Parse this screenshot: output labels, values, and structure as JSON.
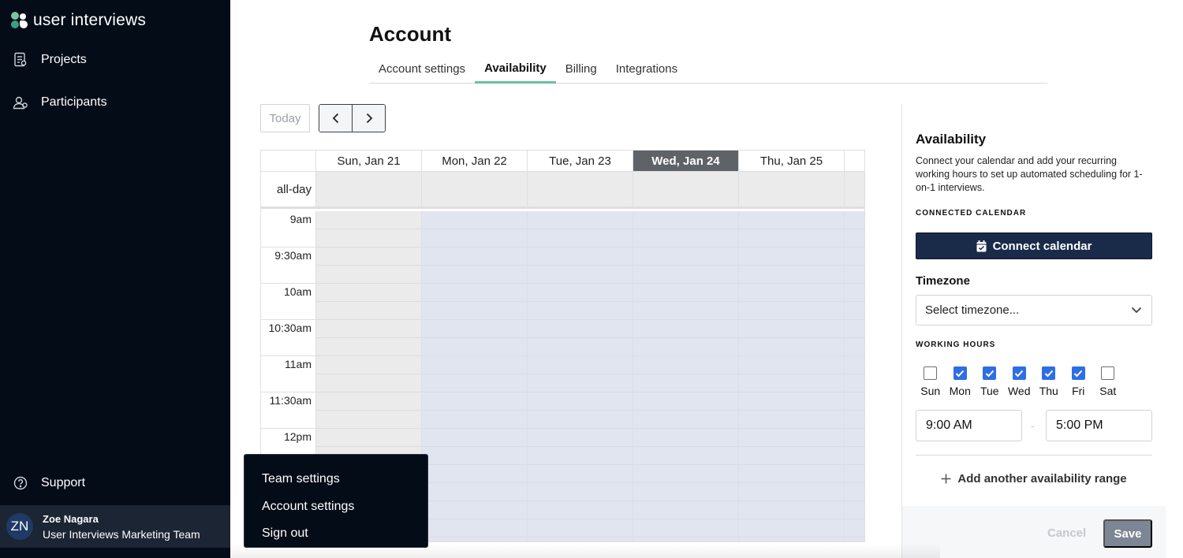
{
  "brand": {
    "logo_text": "user interviews",
    "logo_colors": [
      "#7ac4a6",
      "#ffffff",
      "#3aa17e"
    ]
  },
  "sidebar": {
    "items": [
      {
        "label": "Projects",
        "icon": "document-list-icon"
      },
      {
        "label": "Participants",
        "icon": "people-icon"
      }
    ],
    "support": {
      "label": "Support",
      "icon": "help-circle-icon"
    },
    "user": {
      "initials": "ZN",
      "name": "Zoe Nagara",
      "team": "User Interviews Marketing Team"
    }
  },
  "header": {
    "title": "Account",
    "tabs": [
      {
        "label": "Account settings",
        "active": false
      },
      {
        "label": "Availability",
        "active": true
      },
      {
        "label": "Billing",
        "active": false
      },
      {
        "label": "Integrations",
        "active": false
      }
    ],
    "accent_color": "#6bbfa3"
  },
  "calendar": {
    "today_label": "Today",
    "prev_icon": "chevron-left-icon",
    "next_icon": "chevron-right-icon",
    "allday_label": "all-day",
    "days": [
      {
        "label": "Sun, Jan 21",
        "today": false,
        "working": false
      },
      {
        "label": "Mon, Jan 22",
        "today": false,
        "working": true
      },
      {
        "label": "Tue, Jan 23",
        "today": false,
        "working": true
      },
      {
        "label": "Wed, Jan 24",
        "today": true,
        "working": true
      },
      {
        "label": "Thu, Jan 25",
        "today": false,
        "working": true
      }
    ],
    "times": [
      "9am",
      "9:30am",
      "10am",
      "10:30am",
      "11am",
      "11:30am",
      "12pm"
    ],
    "working_color": "#e1e5f0",
    "off_color": "#ebebeb"
  },
  "panel": {
    "title": "Availability",
    "description": "Connect your calendar and add your recurring working hours to set up automated scheduling for 1-on-1 interviews.",
    "connected_calendar_label": "CONNECTED CALENDAR",
    "connect_button": "Connect calendar",
    "connect_icon": "calendar-check-icon",
    "timezone_label": "Timezone",
    "timezone_placeholder": "Select timezone...",
    "working_hours_label": "WORKING HOURS",
    "days": [
      {
        "label": "Sun",
        "checked": false
      },
      {
        "label": "Mon",
        "checked": true
      },
      {
        "label": "Tue",
        "checked": true
      },
      {
        "label": "Wed",
        "checked": true
      },
      {
        "label": "Thu",
        "checked": true
      },
      {
        "label": "Fri",
        "checked": true
      },
      {
        "label": "Sat",
        "checked": false
      }
    ],
    "start_time": "9:00 AM",
    "end_time": "5:00 PM",
    "separator": "-",
    "add_range": "Add another availability range",
    "cancel": "Cancel",
    "save": "Save",
    "button_color": "#1a2b4a"
  },
  "user_menu": {
    "items": [
      "Team settings",
      "Account settings",
      "Sign out"
    ]
  }
}
